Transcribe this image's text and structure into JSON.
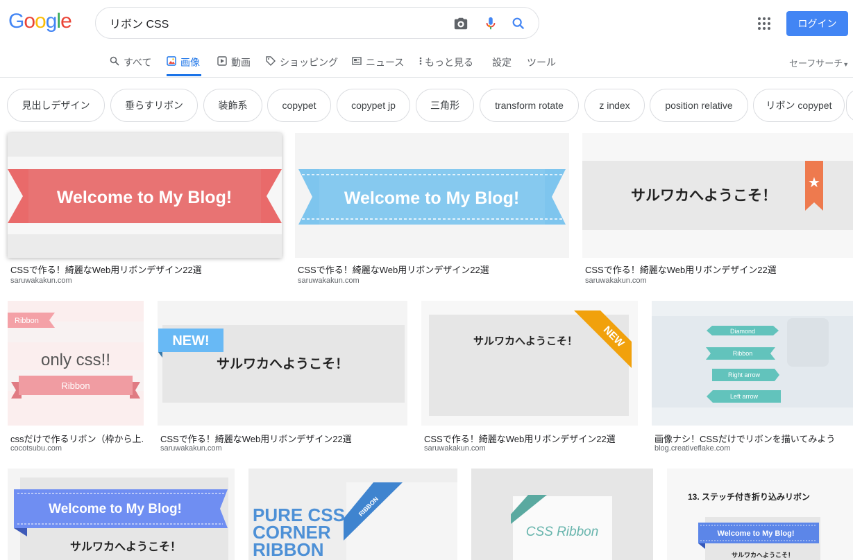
{
  "search": {
    "query": "リボン CSS"
  },
  "header": {
    "login_label": "ログイン",
    "logo_letters": [
      "G",
      "o",
      "o",
      "g",
      "l",
      "e"
    ],
    "logo_colors": [
      "#4285f4",
      "#ea4335",
      "#fbbc05",
      "#4285f4",
      "#34a853",
      "#ea4335"
    ]
  },
  "tabs": [
    {
      "label": "すべて",
      "icon": "search-icon"
    },
    {
      "label": "画像",
      "icon": "image-icon"
    },
    {
      "label": "動画",
      "icon": "video-icon"
    },
    {
      "label": "ショッピング",
      "icon": "tag-icon"
    },
    {
      "label": "ニュース",
      "icon": "news-icon"
    },
    {
      "label": "もっと見る",
      "icon": "more-vert-icon"
    },
    {
      "label": "設定"
    },
    {
      "label": "ツール"
    }
  ],
  "safe_search": "セーフサーチ",
  "chips": [
    "見出しデザイン",
    "垂らすリボン",
    "装飾系",
    "copypet",
    "copypet jp",
    "三角形",
    "transform rotate",
    "z index",
    "position relative",
    "リボン copypet"
  ],
  "results": [
    {
      "caption": "CSSで作る！綺麗なWeb用リボンデザイン22選",
      "site": "saruwakakun.com",
      "text": "Welcome to My Blog!"
    },
    {
      "caption": "CSSで作る！綺麗なWeb用リボンデザイン22選",
      "site": "saruwakakun.com",
      "text": "Welcome to My Blog!"
    },
    {
      "caption": "CSSで作る！綺麗なWeb用リボンデザイン22選",
      "site": "saruwakakun.com",
      "text": "サルワカへようこそ！"
    },
    {
      "caption": "cssだけで作るリボン（枠から上...",
      "site": "cocotsubu.com",
      "text": "only css!!",
      "tag": "Ribbon",
      "ribbon": "Ribbon"
    },
    {
      "caption": "CSSで作る！綺麗なWeb用リボンデザイン22選",
      "site": "saruwakakun.com",
      "text": "サルワカへようこそ！",
      "tag": "NEW!"
    },
    {
      "caption": "CSSで作る！綺麗なWeb用リボンデザイン22選",
      "site": "saruwakakun.com",
      "text": "サルワカへようこそ！",
      "tag": "NEW"
    },
    {
      "caption": "画像ナシ！CSSだけでリボンを描いてみよう",
      "site": "blog.creativeflake.com",
      "items": [
        "Diamond",
        "Ribbon",
        "Right arrow",
        "Left arrow"
      ]
    },
    {
      "text": "Welcome to My Blog!",
      "text2": "サルワカへようこそ！"
    },
    {
      "lines": [
        "PURE CSS",
        "CORNER",
        "RIBBON"
      ],
      "tag": "RIBBON"
    },
    {
      "text": "CSS Ribbon"
    },
    {
      "title": "13. ステッチ付き折り込みリボン",
      "text": "Welcome to My Blog!",
      "text2": "サルワカへようこそ！"
    }
  ]
}
